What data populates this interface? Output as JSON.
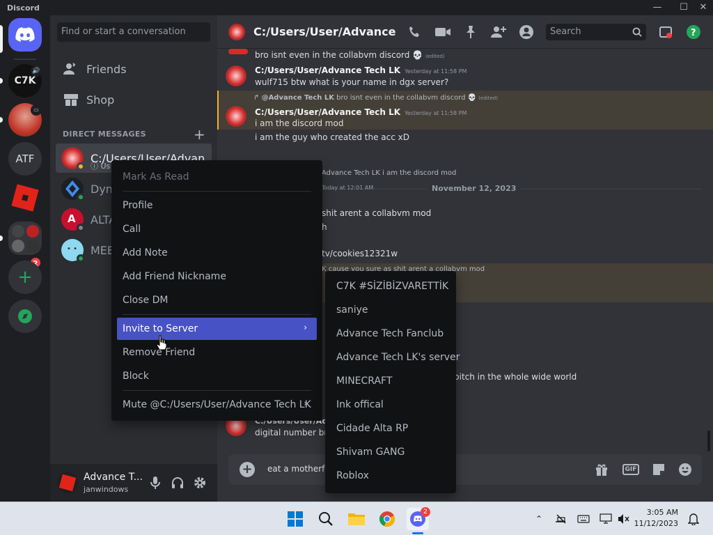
{
  "app": {
    "name": "Discord"
  },
  "window": {
    "minimize": "—",
    "maximize": "☐",
    "close": "✕"
  },
  "rail": {
    "servers": [
      {
        "label": "C7K"
      },
      {
        "label": ""
      },
      {
        "label": "ATF"
      },
      {
        "label": ""
      },
      {
        "label": ""
      }
    ],
    "badge": "2"
  },
  "sidebar": {
    "search_placeholder": "Find or start a conversation",
    "nav": [
      {
        "label": "Friends"
      },
      {
        "label": "Shop"
      }
    ],
    "dm_header": "DIRECT MESSAGES",
    "dm_add": "+",
    "dms": [
      {
        "name": "C:/Users/User/Advan...",
        "sub": "Us",
        "status_color": "#f0b232"
      },
      {
        "name": "Dyno",
        "status_color": "#23a55a"
      },
      {
        "name": "ALTAR",
        "status_color": "#80848e"
      },
      {
        "name": "MEE6",
        "status_color": "#23a55a"
      }
    ]
  },
  "user_panel": {
    "name": "Advance T...",
    "tag": "janwindows"
  },
  "chat": {
    "title": "C:/Users/User/Advance Tech LK",
    "search_placeholder": "Search",
    "date_divider": "November 12, 2023",
    "messages": [
      {
        "text": "bro isnt even in the collabvm discord 💀",
        "edited": "(edited)"
      },
      {
        "author": "C:/Users/User/Advance Tech LK",
        "time": "Yesterday at 11:58 PM",
        "text": "wulf715 btw what is your name in dgx server?"
      },
      {
        "reply_to": "@Advance Tech LK",
        "reply_text": "bro isnt even in the collabvm discord 💀",
        "reply_edited": "(edited)",
        "author": "C:/Users/User/Advance Tech LK",
        "time": "Yesterday at 11:58 PM",
        "text": "i am the discord mod"
      },
      {
        "text": "i am the guy who created the acc xD"
      },
      {
        "text": "Advance Tech LK i am the discord mod"
      },
      {
        "text": "Today at 12:01 AM"
      },
      {
        "text": "shit arent a collabvm mod"
      },
      {
        "text": "h"
      },
      {
        "text": "tv/cookies12321w"
      },
      {
        "text": "K cause you sure as shit arent a collabvm mod"
      },
      {
        "text": "bitch in the whole wide world"
      },
      {
        "author": "C:/Users/User/Adv",
        "text": "digital number bro"
      }
    ],
    "composer_text": "eat a motherfuc"
  },
  "context_menu": {
    "items": [
      {
        "label": "Mark As Read"
      },
      {
        "label": "Profile"
      },
      {
        "label": "Call"
      },
      {
        "label": "Add Note"
      },
      {
        "label": "Add Friend Nickname"
      },
      {
        "label": "Close DM"
      },
      {
        "label": "Invite to Server"
      },
      {
        "label": "Remove Friend"
      },
      {
        "label": "Block"
      },
      {
        "label": "Mute @C:/Users/User/Advance Tech LK"
      }
    ],
    "arrow": "›"
  },
  "invite_submenu": {
    "servers": [
      "C7K #SİZİBİZVARETTİK",
      "saniye",
      "Advance Tech Fanclub",
      "Advance Tech LK's server",
      "MINECRAFT",
      "Ink offical",
      "Cidade Alta RP",
      "Shivam GANG",
      "Roblox"
    ]
  },
  "taskbar": {
    "time": "3:05 AM",
    "date": "11/12/2023",
    "discord_badge": "2"
  },
  "colors": {
    "accent": "#5865f2",
    "menu_hover": "#4752c4",
    "mention_highlight": "#f0b232",
    "online": "#23a55a"
  }
}
